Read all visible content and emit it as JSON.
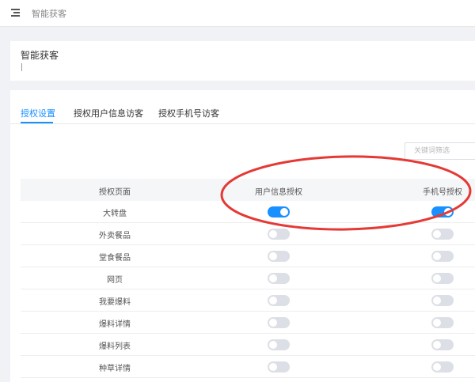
{
  "topbar": {
    "title": "智能获客",
    "menu_icon": "menu-fold-icon"
  },
  "header": {
    "title": "智能获客"
  },
  "tabs": [
    {
      "label": "授权设置",
      "active": true
    },
    {
      "label": "授权用户信息访客",
      "active": false
    },
    {
      "label": "授权手机号访客",
      "active": false
    }
  ],
  "filter": {
    "placeholder": "关键词筛选"
  },
  "table": {
    "columns": [
      "授权页面",
      "用户信息授权",
      "手机号授权"
    ],
    "rows": [
      {
        "name": "大转盘",
        "user_info": true,
        "phone": true
      },
      {
        "name": "外卖餐品",
        "user_info": false,
        "phone": false
      },
      {
        "name": "堂食餐品",
        "user_info": false,
        "phone": false
      },
      {
        "name": "网页",
        "user_info": false,
        "phone": false
      },
      {
        "name": "我要爆料",
        "user_info": false,
        "phone": false
      },
      {
        "name": "爆料详情",
        "user_info": false,
        "phone": false
      },
      {
        "name": "爆料列表",
        "user_info": false,
        "phone": false
      },
      {
        "name": "种草详情",
        "user_info": false,
        "phone": false
      }
    ]
  },
  "colors": {
    "accent": "#1890ff",
    "toggle_off": "#dcdfe6",
    "annotation": "#e53935"
  }
}
